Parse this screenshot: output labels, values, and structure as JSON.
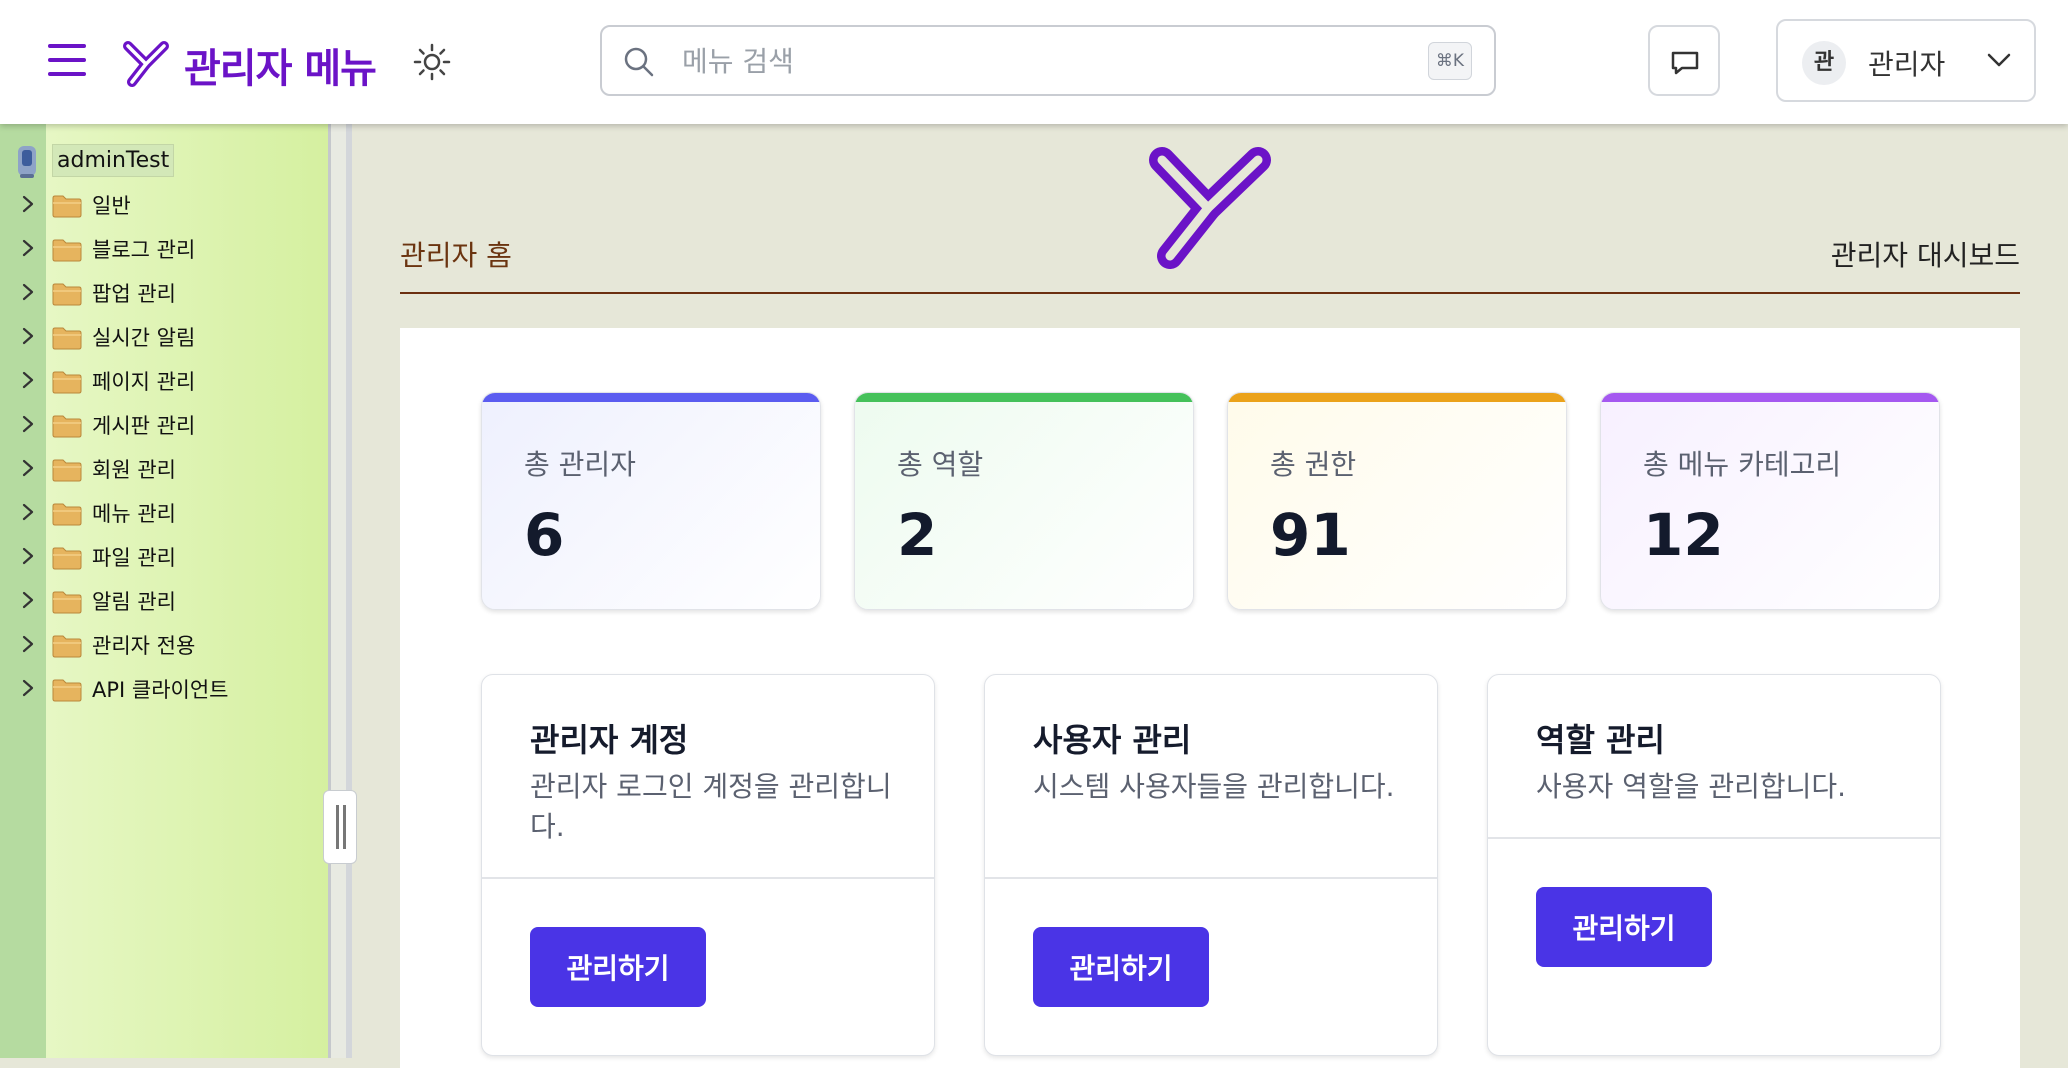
{
  "header": {
    "title": "관리자 메뉴",
    "search_placeholder": "메뉴 검색",
    "search_shortcut": "⌘K",
    "user_avatar": "관",
    "user_name": "관리자"
  },
  "sidebar": {
    "root_label": "adminTest",
    "items": [
      {
        "label": "일반"
      },
      {
        "label": "블로그 관리"
      },
      {
        "label": "팝업 관리"
      },
      {
        "label": "실시간 알림"
      },
      {
        "label": "페이지 관리"
      },
      {
        "label": "게시판 관리"
      },
      {
        "label": "회원 관리"
      },
      {
        "label": "메뉴 관리"
      },
      {
        "label": "파일 관리"
      },
      {
        "label": "알림 관리"
      },
      {
        "label": "관리자 전용"
      },
      {
        "label": "API 클라이언트"
      }
    ]
  },
  "main": {
    "breadcrumb": "관리자 홈",
    "page_title": "관리자 대시보드",
    "stats": [
      {
        "label": "총 관리자",
        "value": "6",
        "color": "#5b5cf0"
      },
      {
        "label": "총 역할",
        "value": "2",
        "color": "#45c15a"
      },
      {
        "label": "총 권한",
        "value": "91",
        "color": "#eba21a"
      },
      {
        "label": "총 메뉴 카테고리",
        "value": "12",
        "color": "#a558f0"
      }
    ],
    "features": [
      {
        "title": "관리자 계정",
        "description": "관리자 로그인 계정을 관리합니다.",
        "button": "관리하기"
      },
      {
        "title": "사용자 관리",
        "description": "시스템 사용자들을 관리합니다.",
        "button": "관리하기"
      },
      {
        "title": "역할 관리",
        "description": "사용자 역할을 관리합니다.",
        "button": "관리하기"
      }
    ]
  },
  "colors": {
    "brand": "#6b13c7",
    "primary_button": "#4a34e6",
    "breadcrumb": "#6b3410"
  }
}
